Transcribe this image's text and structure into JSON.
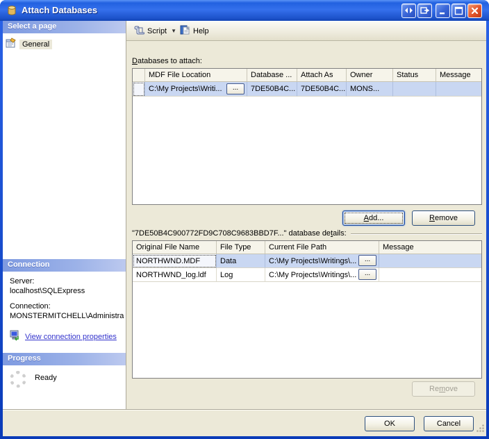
{
  "colors": {
    "titlebar_blue": "#2261e0",
    "section_header_blue": "#7e9ae0",
    "selection_blue": "#c9d7f2",
    "close_button_red": "#e2542c",
    "link_blue": "#3333cc",
    "dialog_beige": "#ece9d8"
  },
  "window": {
    "title": "Attach Databases"
  },
  "toolbar": {
    "script_label": "Script",
    "help_label": "Help"
  },
  "sidebar": {
    "select_page_header": "Select a page",
    "general_item": "General",
    "connection_header": "Connection",
    "server_label": "Server:",
    "server_value": "localhost\\SQLExpress",
    "connection_label": "Connection:",
    "connection_value": "MONSTERMITCHELL\\Administra",
    "view_link": "View connection properties",
    "progress_header": "Progress",
    "progress_status": "Ready"
  },
  "main": {
    "attach_label": {
      "pre": "",
      "key": "D",
      "post": "atabases to attach:"
    },
    "attach_table": {
      "columns": [
        "",
        "MDF File Location",
        "Database ...",
        "Attach As",
        "Owner",
        "Status",
        "Message"
      ],
      "rows": [
        {
          "mdf": "C:\\My Projects\\Writi...",
          "browse": "...",
          "database": "7DE50B4C...",
          "attach_as": "7DE50B4C...",
          "owner": "MONS...",
          "status": "",
          "message": ""
        }
      ]
    },
    "add_button": {
      "pre": "",
      "key": "A",
      "post": "dd..."
    },
    "remove_button": {
      "pre": "",
      "key": "R",
      "post": "emove"
    },
    "details_label": {
      "pre": "\"7DE50B4C900772FD9C708C9683BBD7F...\" database de",
      "key": "t",
      "post": "ails:"
    },
    "details_table": {
      "columns": [
        "Original File Name",
        "File Type",
        "Current File Path",
        "Message"
      ],
      "rows": [
        {
          "name": "NORTHWND.MDF",
          "type": "Data",
          "path": "C:\\My Projects\\Writings\\...",
          "browse": "...",
          "message": ""
        },
        {
          "name": "NORTHWND_log.ldf",
          "type": "Log",
          "path": "C:\\My Projects\\Writings\\...",
          "browse": "...",
          "message": ""
        }
      ]
    },
    "remove_details_button": {
      "pre": "Re",
      "key": "m",
      "post": "ove"
    }
  },
  "footer": {
    "ok_button": "OK",
    "cancel_button": "Cancel"
  }
}
